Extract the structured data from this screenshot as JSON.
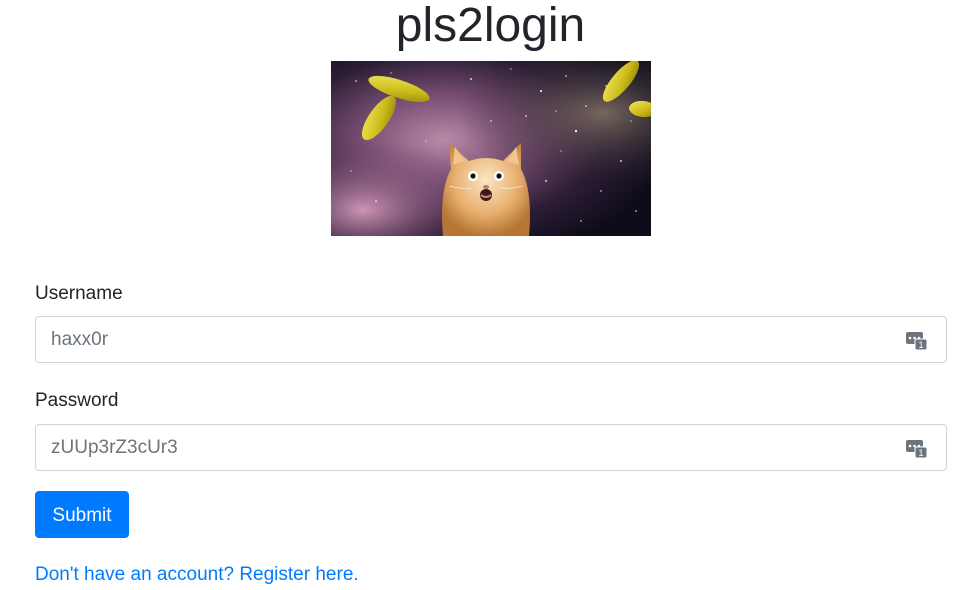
{
  "page": {
    "title": "pls2login"
  },
  "hero_image": {
    "description": "nyan-style space cat with flying pickles"
  },
  "form": {
    "username_label": "Username",
    "username_value": "haxx0r",
    "password_label": "Password",
    "password_value": "zUUp3rZ3cUr3",
    "submit_label": "Submit"
  },
  "footer": {
    "register_link": "Don't have an account? Register here."
  },
  "colors": {
    "primary": "#007bff",
    "text": "#212529",
    "muted": "#6c757d",
    "border": "#ced4da"
  }
}
